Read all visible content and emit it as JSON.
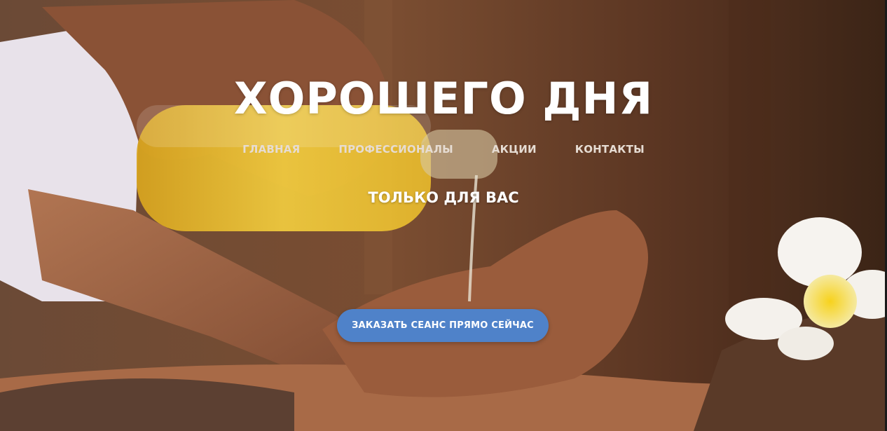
{
  "hero": {
    "title": "ХОРОШЕГО ДНЯ",
    "tagline": "ТОЛЬКО ДЛЯ ВАС",
    "cta_label": "ЗАКАЗАТЬ СЕАНС ПРЯМО СЕЙЧАС",
    "image": "massage-oil-photo"
  },
  "nav": {
    "items": [
      {
        "label": "ГЛАВНАЯ"
      },
      {
        "label": "ПРОФЕССИОНАЛЫ"
      },
      {
        "label": "АКЦИИ"
      },
      {
        "label": "КОНТАКТЫ"
      }
    ]
  },
  "colors": {
    "accent": "#4f82c9",
    "text": "#ffffff",
    "nav_text": "#e6dcd3"
  }
}
